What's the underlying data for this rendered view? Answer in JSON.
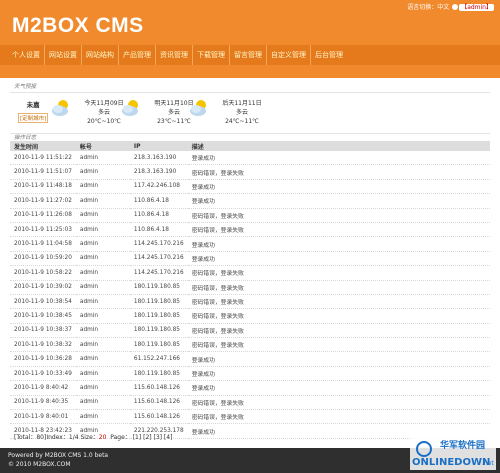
{
  "header": {
    "lang_label": "语言切换：",
    "lang_value": "中文",
    "user_label": "【admin】",
    "brand": "M2BOX CMS"
  },
  "nav": [
    "个人设置",
    "网站设置",
    "网站结构",
    "产品管理",
    "资讯管理",
    "下载管理",
    "留言管理",
    "自定义管理",
    "后台管理"
  ],
  "weather": {
    "section_title": "天气预报",
    "city": "未嘉",
    "city_link": "[定制城市]",
    "days": [
      {
        "date": "今天11月09日",
        "cond": "多云",
        "temp": "20℃~10℃"
      },
      {
        "date": "明天11月10日",
        "cond": "多云",
        "temp": "23℃~11℃"
      },
      {
        "date": "后天11月11日",
        "cond": "多云",
        "temp": "24℃~11℃"
      }
    ]
  },
  "log": {
    "section_title": "操作日志",
    "columns": [
      "发生时间",
      "帐号",
      "IP",
      "描述"
    ],
    "rows": [
      [
        "2010-11-9 11:51:22",
        "admin",
        "218.3.163.190",
        "登录成功"
      ],
      [
        "2010-11-9 11:51:07",
        "admin",
        "218.3.163.190",
        "密码错误，登录失败"
      ],
      [
        "2010-11-9 11:48:18",
        "admin",
        "117.42.246.108",
        "登录成功"
      ],
      [
        "2010-11-9 11:27:02",
        "admin",
        "110.86.4.18",
        "登录成功"
      ],
      [
        "2010-11-9 11:26:08",
        "admin",
        "110.86.4.18",
        "密码错误，登录失败"
      ],
      [
        "2010-11-9 11:25:03",
        "admin",
        "110.86.4.18",
        "密码错误，登录失败"
      ],
      [
        "2010-11-9 11:04:58",
        "admin",
        "114.245.170.216",
        "登录成功"
      ],
      [
        "2010-11-9 10:59:20",
        "admin",
        "114.245.170.216",
        "登录成功"
      ],
      [
        "2010-11-9 10:58:22",
        "admin",
        "114.245.170.216",
        "密码错误，登录失败"
      ],
      [
        "2010-11-9 10:39:02",
        "admin",
        "180.119.180.85",
        "密码错误，登录失败"
      ],
      [
        "2010-11-9 10:38:54",
        "admin",
        "180.119.180.85",
        "密码错误，登录失败"
      ],
      [
        "2010-11-9 10:38:45",
        "admin",
        "180.119.180.85",
        "密码错误，登录失败"
      ],
      [
        "2010-11-9 10:38:37",
        "admin",
        "180.119.180.85",
        "密码错误，登录失败"
      ],
      [
        "2010-11-9 10:38:32",
        "admin",
        "180.119.180.85",
        "密码错误，登录失败"
      ],
      [
        "2010-11-9 10:36:28",
        "admin",
        "61.152.247.166",
        "登录成功"
      ],
      [
        "2010-11-9 10:33:49",
        "admin",
        "180.119.180.85",
        "登录成功"
      ],
      [
        "2010-11-9 8:40:42",
        "admin",
        "115.60.148.126",
        "登录成功"
      ],
      [
        "2010-11-9 8:40:35",
        "admin",
        "115.60.148.126",
        "密码错误，登录失败"
      ],
      [
        "2010-11-9 8:40:01",
        "admin",
        "115.60.148.126",
        "密码错误，登录失败"
      ],
      [
        "2010-11-8 23:42:23",
        "admin",
        "221.220.253.178",
        "登录成功"
      ]
    ]
  },
  "pager": {
    "total": "[Total：80]",
    "index_label": "Index：",
    "index_value": "1/4",
    "size_label": "Size：",
    "size_value": "20",
    "page_label": "Page：",
    "pages": "[1] [2] [3] [4]"
  },
  "footer": {
    "line1": "Powered by M2BOX CMS 1.0 beta",
    "line2": "© 2010 M2BOX.COM"
  },
  "watermark": {
    "line1": "华军软件园",
    "line2": "ONLINEDOWN",
    "line3": ".net"
  },
  "colors": {
    "header": "#f08a2c",
    "nav": "#e57a1c",
    "footer": "#2f2f2f"
  }
}
